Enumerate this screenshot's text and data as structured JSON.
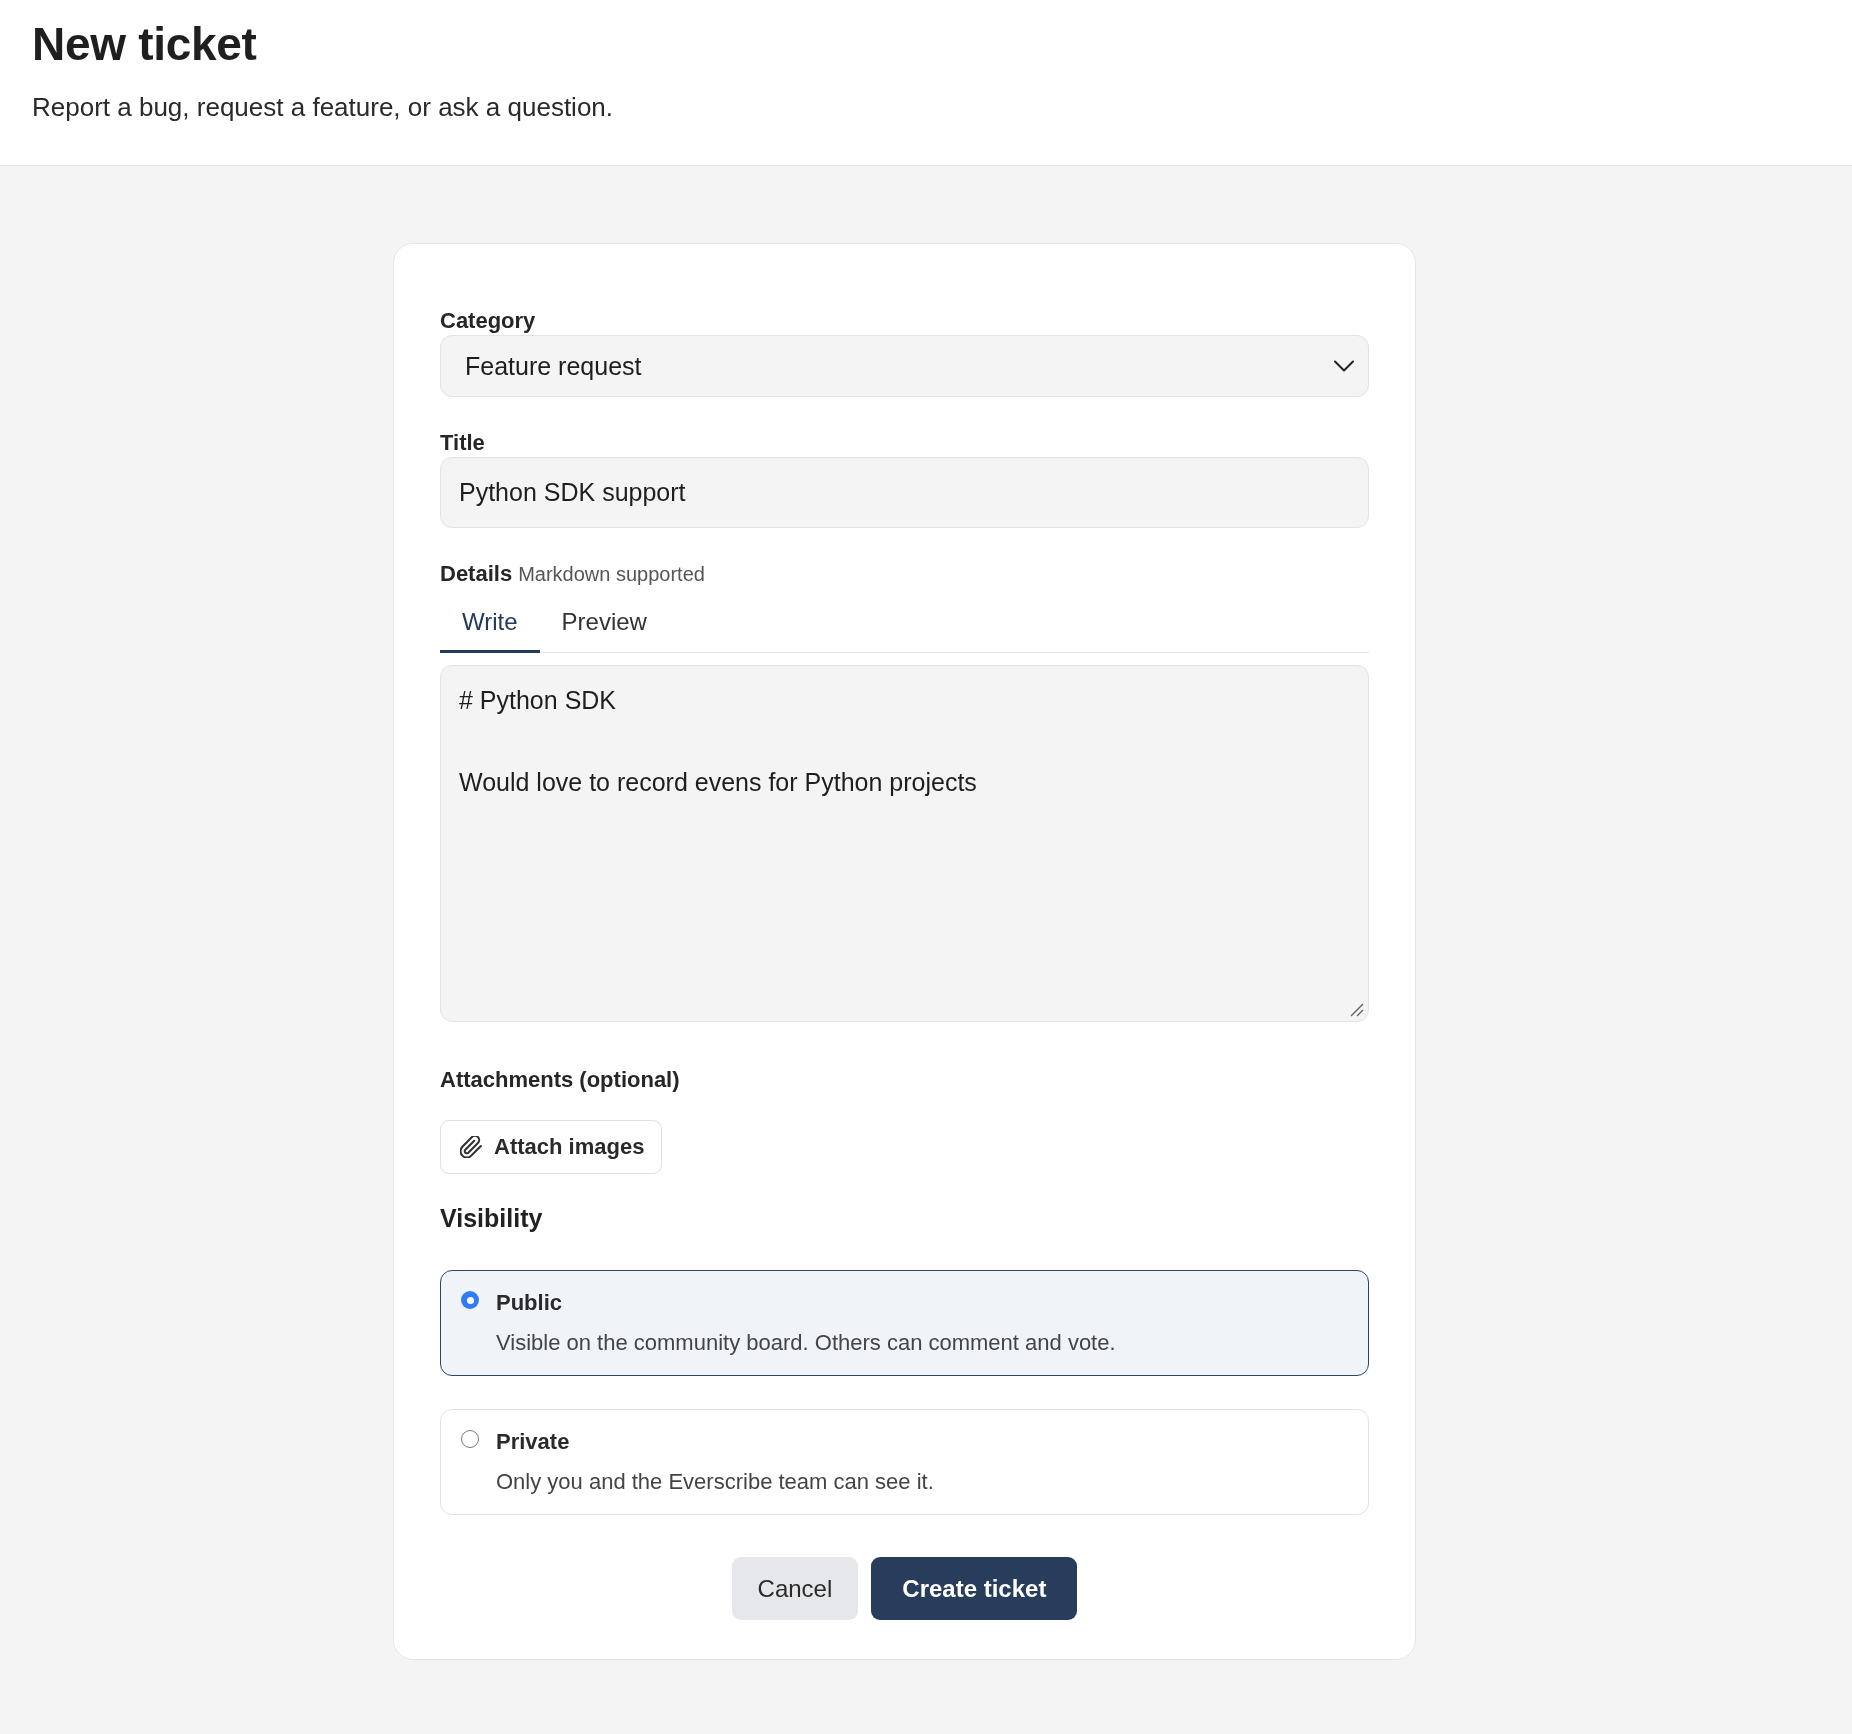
{
  "header": {
    "title": "New ticket",
    "subtitle": "Report a bug, request a feature, or ask a question."
  },
  "form": {
    "category": {
      "label": "Category",
      "value": "Feature request"
    },
    "title": {
      "label": "Title",
      "value": "Python SDK support"
    },
    "details": {
      "label": "Details",
      "hint": "Markdown supported",
      "tabs": [
        {
          "label": "Write",
          "selected": true
        },
        {
          "label": "Preview",
          "selected": false
        }
      ],
      "value": "# Python SDK\n\nWould love to record evens for Python projects"
    },
    "attachments": {
      "label": "Attachments (optional)",
      "button": "Attach images"
    },
    "visibility": {
      "label": "Visibility",
      "options": [
        {
          "label": "Public",
          "description": "Visible on the community board. Others can comment and vote.",
          "selected": true
        },
        {
          "label": "Private",
          "description": "Only you and the Everscribe team can see it.",
          "selected": false
        }
      ]
    },
    "buttons": [
      {
        "label": "Cancel",
        "kind": "secondary"
      },
      {
        "label": "Create ticket",
        "kind": "primary"
      }
    ]
  }
}
